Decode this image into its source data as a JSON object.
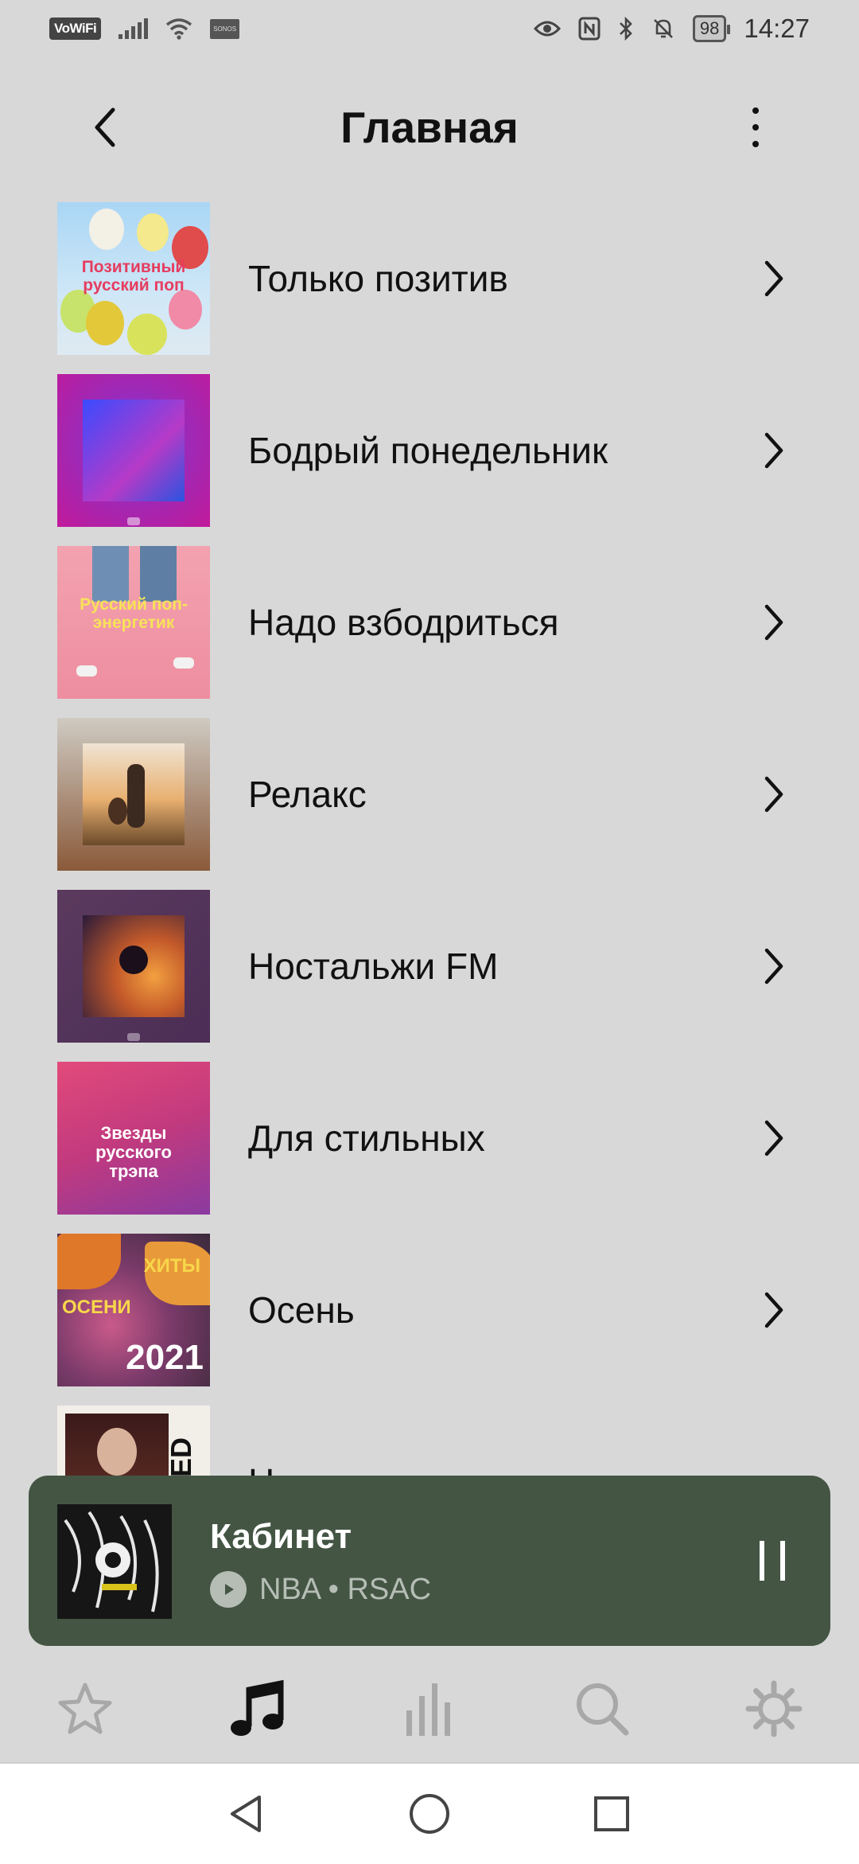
{
  "status_bar": {
    "left_badge": "VoWiFi",
    "sim_label": "SONOS",
    "battery": "98",
    "time": "14:27"
  },
  "header": {
    "title": "Главная"
  },
  "playlists": [
    {
      "label": "Только позитив",
      "cover_text": "Позитивный русский поп"
    },
    {
      "label": "Бодрый понедельник",
      "cover_text": ""
    },
    {
      "label": "Надо взбодриться",
      "cover_text": "Русский поп-энергетик"
    },
    {
      "label": "Релакс",
      "cover_text": ""
    },
    {
      "label": "Ностальжи FM",
      "cover_text": ""
    },
    {
      "label": "Для стильных",
      "cover_text": "Звезды русского трэпа"
    },
    {
      "label": "Осень",
      "cover_text_1": "ХИТЫ",
      "cover_text_2": "ОСЕНИ",
      "cover_text_3": "2021"
    },
    {
      "label": "Н",
      "cover_text": "ASED"
    }
  ],
  "now_playing": {
    "title": "Кабинет",
    "subtitle": "NBA • RSAC"
  },
  "bottom_tabs": [
    {
      "name": "favorites",
      "icon": "star-icon"
    },
    {
      "name": "music",
      "icon": "music-note-icon",
      "active": true
    },
    {
      "name": "rooms",
      "icon": "equalizer-icon"
    },
    {
      "name": "search",
      "icon": "search-icon"
    },
    {
      "name": "settings",
      "icon": "gear-icon"
    }
  ],
  "colors": {
    "background": "#d8d8d8",
    "player": "#445544",
    "active_tab": "#111111",
    "inactive_tab": "#a8a8a8"
  }
}
